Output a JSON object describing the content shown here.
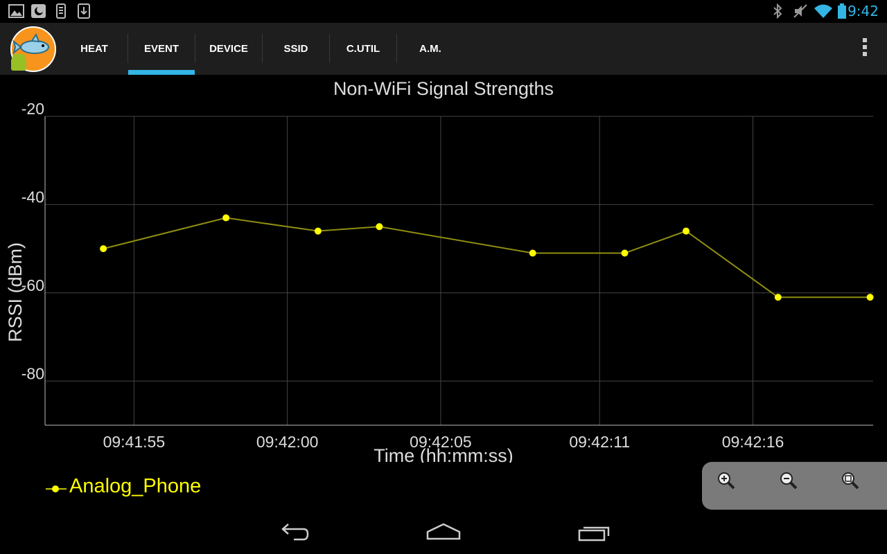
{
  "status_bar": {
    "time": "9:42",
    "left_icons": [
      "gallery-icon",
      "app-notification-icon",
      "phone-device-icon",
      "download-icon"
    ],
    "right_icons": [
      "bluetooth-icon",
      "muted-icon",
      "wifi-icon",
      "battery-icon"
    ]
  },
  "action_bar": {
    "tabs": [
      {
        "label": "HEAT"
      },
      {
        "label": "EVENT"
      },
      {
        "label": "DEVICE"
      },
      {
        "label": "SSID"
      },
      {
        "label": "C.UTIL"
      },
      {
        "label": "A.M."
      }
    ],
    "selected_tab": "EVENT"
  },
  "chart_data": {
    "type": "line",
    "title": "Non-WiFi Signal Strengths",
    "xlabel": "Time (hh:mm:ss)",
    "ylabel": "RSSI (dBm)",
    "x_tick_labels": [
      "09:41:55",
      "09:42:00",
      "09:42:05",
      "09:42:11",
      "09:42:16"
    ],
    "y_ticks": [
      -20,
      -40,
      -60,
      -80
    ],
    "ylim": [
      -90,
      -20
    ],
    "grid": true,
    "legend_position": "bottom-left",
    "series": [
      {
        "name": "Analog_Phone",
        "color": "#ffff00",
        "x": [
          "09:41:54",
          "09:41:58",
          "09:42:01",
          "09:42:03",
          "09:42:08",
          "09:42:11",
          "09:42:13",
          "09:42:16",
          "09:42:19"
        ],
        "values": [
          -50,
          -43,
          -46,
          -45,
          -51,
          -51,
          -46,
          -61,
          -61
        ]
      }
    ]
  },
  "zoom_controls": [
    "zoom-in-icon",
    "zoom-out-icon",
    "zoom-fit-icon"
  ],
  "nav_bar": [
    "back-icon",
    "home-icon",
    "recent-apps-icon"
  ]
}
